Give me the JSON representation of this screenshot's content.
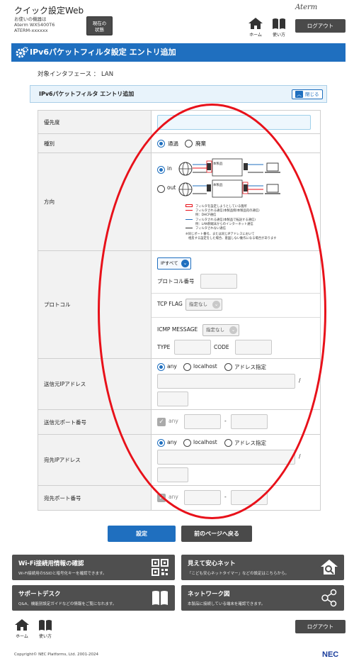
{
  "header": {
    "app_title": "クイック設定Web",
    "device_caption": "お使いの機器は",
    "device_model": "Aterm WX5400T6",
    "device_id": "ATERM-xxxxxx",
    "status_button_line1": "現在の",
    "status_button_line2": "状態",
    "brand": "Aterm",
    "home_label": "ホーム",
    "help_label": "使い方",
    "logout_label": "ログアウト"
  },
  "page": {
    "title": "IPv6パケットフィルタ設定 エントリ追加",
    "interface_line": "対象インタフェース ： LAN",
    "section_title": "IPv6パケットフィルタ エントリ追加",
    "close_label": "閉じる"
  },
  "form": {
    "priority_label": "優先度",
    "type_label": "種別",
    "type_options": [
      "通過",
      "廃棄"
    ],
    "direction_label": "方向",
    "direction_options": [
      "in",
      "out"
    ],
    "diagram": {
      "device_label": "本製品",
      "legend": [
        "フィルタを設定しようとしている箇所",
        "フィルタされる通信(本製品側/本製品宛の通信)",
        "例：DHCP通信",
        "フィルタされる通信(本製品で転送する通信)",
        "例：LAN側端末からのインターネット通信",
        "フィルタされない通信"
      ],
      "note_line1": "※同じポート番号、または同じIPアドレスにおいて",
      "note_line2": "相反する設定をした場合、意図しない動作になる場合があります"
    },
    "protocol_label": "プロトコル",
    "protocol_select": "IPすべて",
    "protocol_number_label": "プロトコル番号",
    "tcp_flag_label": "TCP FLAG",
    "tcp_flag_select": "指定なし",
    "icmp_label": "ICMP MESSAGE",
    "icmp_select": "指定なし",
    "type_field_label": "TYPE",
    "code_field_label": "CODE",
    "src_ip_label": "送信元IPアドレス",
    "ip_options": [
      "any",
      "localhost",
      "アドレス指定"
    ],
    "slash": "/",
    "src_port_label": "送信元ポート番号",
    "port_any": "any",
    "dash": "-",
    "dst_ip_label": "宛先IPアドレス",
    "dst_port_label": "宛先ポート番号"
  },
  "buttons": {
    "set": "設定",
    "back": "前のページへ戻る"
  },
  "cards": [
    {
      "title": "Wi-Fi接続用情報の確認",
      "desc": "Wi-Fi接続用のSSIDと暗号化キーを確認できます。",
      "icon": "qr-code-icon"
    },
    {
      "title": "見えて安心ネット",
      "desc": "「こども安心ネットタイマー」などの設定はこちらから。",
      "icon": "home-search-icon"
    },
    {
      "title": "サポートデスク",
      "desc": "Q&A、機能別設定ガイドなどの情報をご覧になれます。",
      "icon": "book-icon"
    },
    {
      "title": "ネットワーク図",
      "desc": "本製品に接続している端末を確認できます。",
      "icon": "network-icon"
    }
  ],
  "footer": {
    "copyright": "Copyright© NEC Platforms, Ltd. 2001-2024",
    "nec_logo": "NEC"
  },
  "colors": {
    "accent": "#1f6fbf",
    "dark_button": "#4a4a4a",
    "annotation": "#e8111a"
  }
}
